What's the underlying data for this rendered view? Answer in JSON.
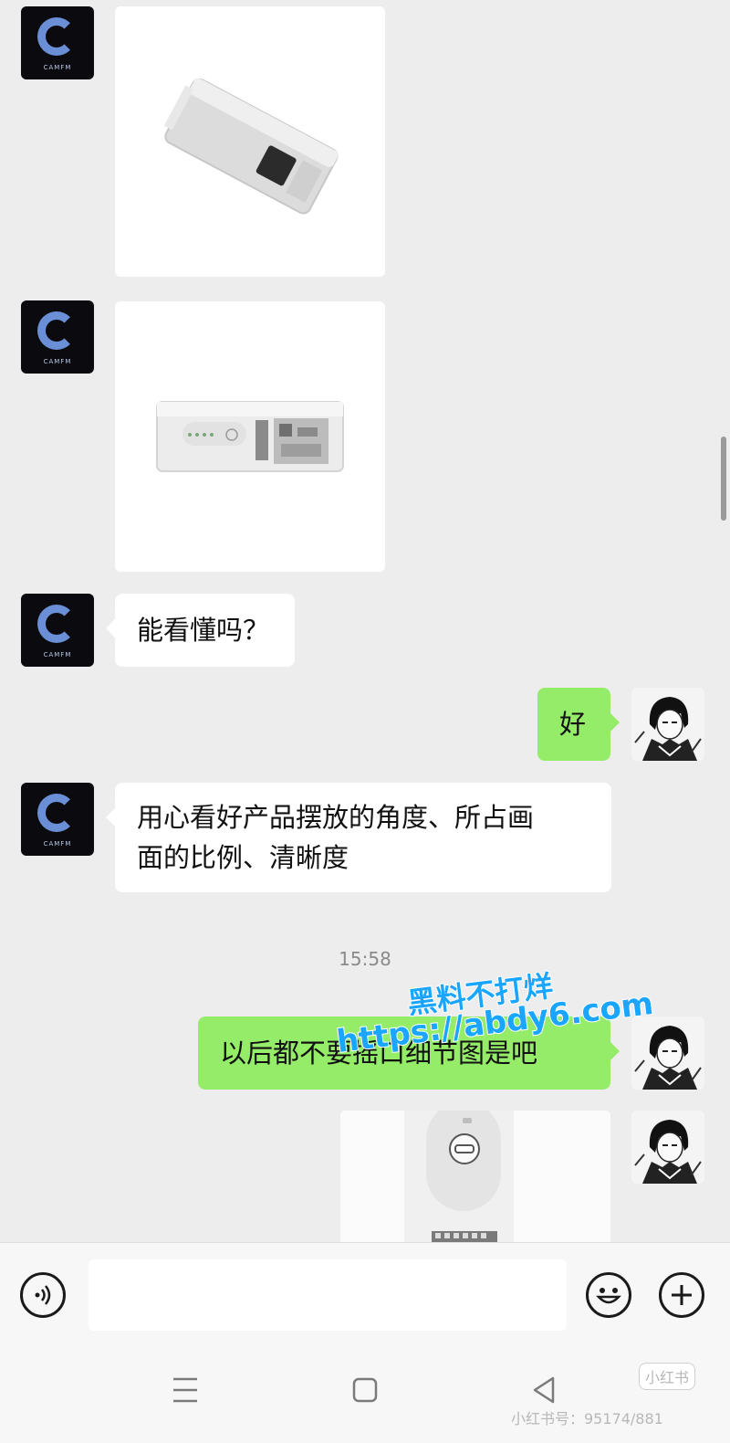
{
  "messages": [
    {
      "id": "m1",
      "sender": "contact",
      "type": "image",
      "image": "white-device-angled-photo"
    },
    {
      "id": "m2",
      "sender": "contact",
      "type": "image",
      "image": "white-device-side-photo"
    },
    {
      "id": "m3",
      "sender": "contact",
      "type": "text",
      "text": "能看懂吗？"
    },
    {
      "id": "m4",
      "sender": "me",
      "type": "text",
      "text": "好"
    },
    {
      "id": "m5",
      "sender": "contact",
      "type": "text",
      "line1": "用心看好产品摆放的角度、所占画",
      "line2": "面的比例、清晰度"
    },
    {
      "id": "m6",
      "sender": "me",
      "type": "text",
      "text": "以后都不要摇口细节图是吧"
    },
    {
      "id": "m7",
      "sender": "me",
      "type": "image",
      "image": "white-device-closeup-photo"
    }
  ],
  "timestamp": "15:58",
  "contact_avatar": {
    "label": "CAMFM",
    "icon": "brand-c-logo-icon"
  },
  "watermark": {
    "line1": "黑料不打烊",
    "line2": "https://abdy6.com"
  },
  "input_bar": {
    "voice_icon": "voice-icon",
    "emoji_icon": "emoji-icon",
    "plus_icon": "plus-icon",
    "placeholder": ""
  },
  "nav_bar": {
    "menu_icon": "menu-icon",
    "home_icon": "home-icon",
    "back_icon": "back-icon"
  },
  "footer": {
    "brand": "小红书",
    "id_text": "小红书号：95174/881"
  },
  "colors": {
    "background": "#ededed",
    "outgoing_bubble": "#95ec69",
    "incoming_bubble": "#ffffff"
  }
}
